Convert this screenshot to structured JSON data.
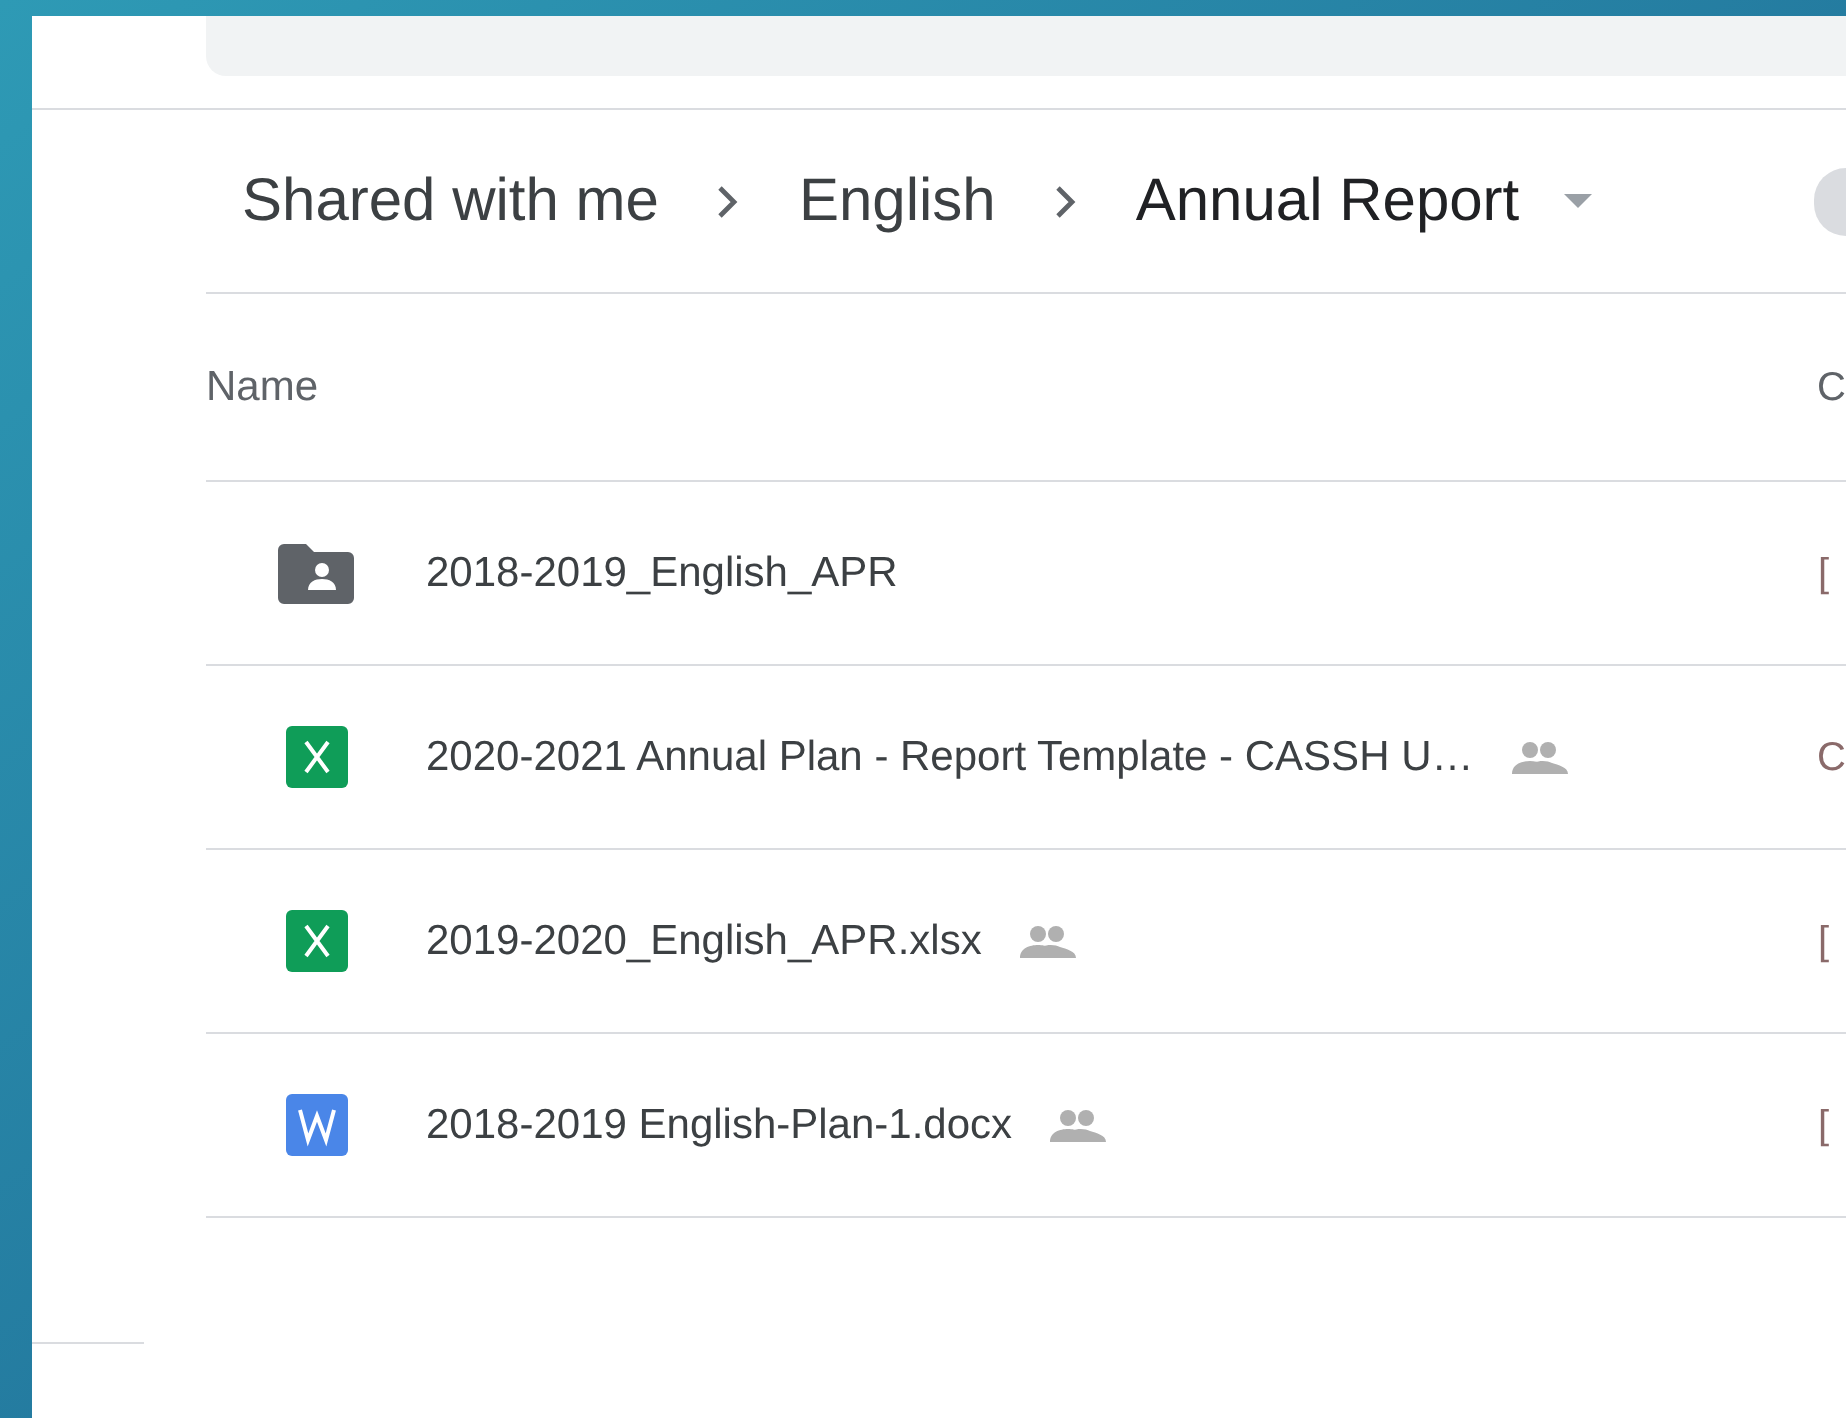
{
  "breadcrumb": [
    {
      "label": "Shared with me",
      "current": false
    },
    {
      "label": "English",
      "current": false
    },
    {
      "label": "Annual Report",
      "current": true
    }
  ],
  "table": {
    "columns": [
      "Name",
      "C"
    ],
    "rows": [
      {
        "kind": "folder",
        "name": "2018-2019_English_APR",
        "shared": false,
        "column_2": "["
      },
      {
        "kind": "sheet",
        "name": "2020-2021 Annual Plan - Report Template - CASSH U…",
        "shared": true,
        "column_2": "C"
      },
      {
        "kind": "sheet",
        "name": "2019-2020_English_APR.xlsx",
        "shared": true,
        "column_2": "["
      },
      {
        "kind": "doc",
        "name": "2018-2019 English-Plan-1.docx",
        "shared": true,
        "column_2": "["
      }
    ]
  }
}
